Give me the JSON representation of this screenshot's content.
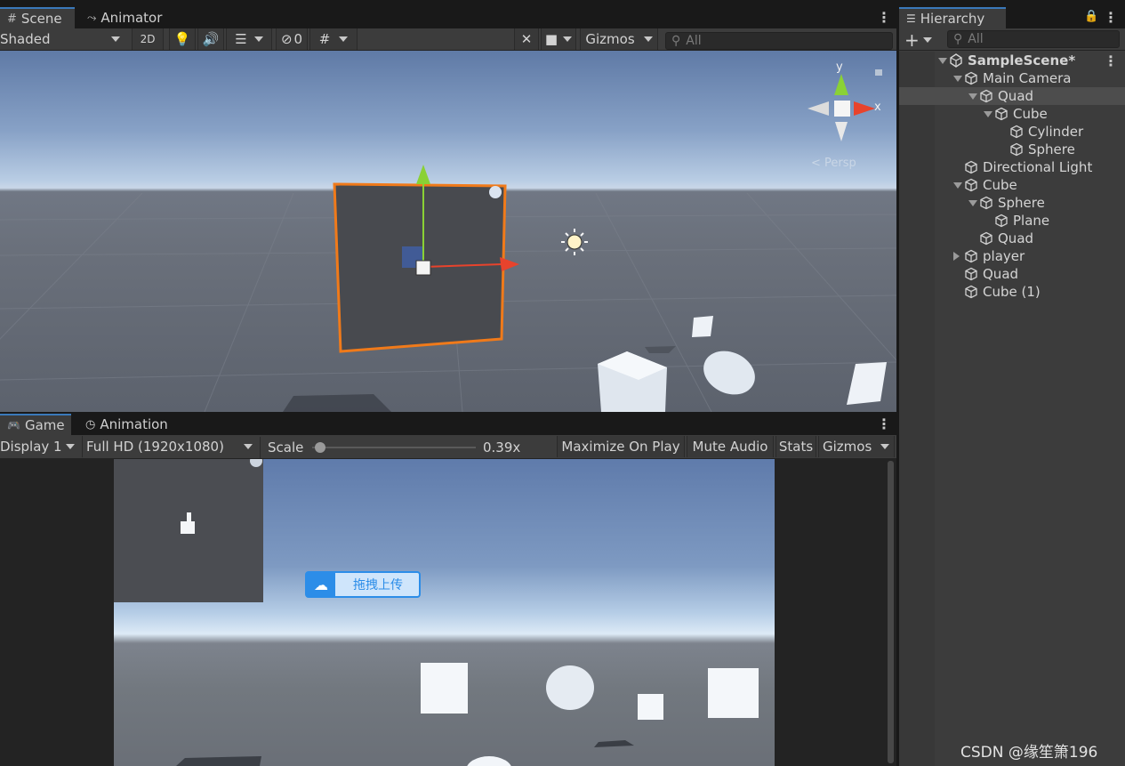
{
  "scene_panel": {
    "tabs": [
      {
        "label": "Scene",
        "icon": "grid-icon"
      },
      {
        "label": "Animator",
        "icon": "animator-icon"
      }
    ],
    "toolbar": {
      "shading_mode": "Shaded",
      "mode_2d": "2D",
      "hidden_count": "0",
      "gizmos": "Gizmos",
      "search_placeholder": "All"
    },
    "gizmo_axes": {
      "y": "y",
      "x": "x"
    },
    "persp_label": "< Persp"
  },
  "game_panel": {
    "tabs": [
      {
        "label": "Game",
        "icon": "gamepad-icon"
      },
      {
        "label": "Animation",
        "icon": "clock-icon"
      }
    ],
    "toolbar": {
      "display": "Display 1",
      "resolution": "Full HD (1920x1080)",
      "scale_label": "Scale",
      "scale_value": "0.39x",
      "scale_fraction": 0.02,
      "maximize_on_play": "Maximize On Play",
      "mute_audio": "Mute Audio",
      "stats": "Stats",
      "gizmos": "Gizmos"
    },
    "upload_badge": "拖拽上传"
  },
  "hierarchy": {
    "tab_label": "Hierarchy",
    "search_placeholder": "All",
    "items": [
      {
        "label": "SampleScene*",
        "depth": 0,
        "expand": "down",
        "icon": "unity-scene-icon",
        "bold": true
      },
      {
        "label": "Main Camera",
        "depth": 1,
        "expand": "down",
        "icon": "cube-icon"
      },
      {
        "label": "Quad",
        "depth": 2,
        "expand": "down",
        "icon": "cube-icon",
        "selected": true
      },
      {
        "label": "Cube",
        "depth": 3,
        "expand": "down",
        "icon": "cube-icon"
      },
      {
        "label": "Cylinder",
        "depth": 4,
        "expand": "none",
        "icon": "cube-icon"
      },
      {
        "label": "Sphere",
        "depth": 4,
        "expand": "none",
        "icon": "cube-icon"
      },
      {
        "label": "Directional Light",
        "depth": 1,
        "expand": "none",
        "icon": "cube-icon"
      },
      {
        "label": "Cube",
        "depth": 1,
        "expand": "down",
        "icon": "cube-icon"
      },
      {
        "label": "Sphere",
        "depth": 2,
        "expand": "down",
        "icon": "cube-icon"
      },
      {
        "label": "Plane",
        "depth": 3,
        "expand": "none",
        "icon": "cube-icon"
      },
      {
        "label": "Quad",
        "depth": 2,
        "expand": "none",
        "icon": "cube-icon"
      },
      {
        "label": "player",
        "depth": 1,
        "expand": "right",
        "icon": "cube-icon"
      },
      {
        "label": "Quad",
        "depth": 1,
        "expand": "none",
        "icon": "cube-icon"
      },
      {
        "label": "Cube (1)",
        "depth": 1,
        "expand": "none",
        "icon": "cube-icon"
      }
    ]
  },
  "watermark": "CSDN @缘笙箫196",
  "colors": {
    "selection_outline": "#f07a1a",
    "axis_y": "#8ad135",
    "axis_x": "#e8432c",
    "hierarchy_selected": "#4d4d4d",
    "tab_accent": "#3a79bb"
  }
}
